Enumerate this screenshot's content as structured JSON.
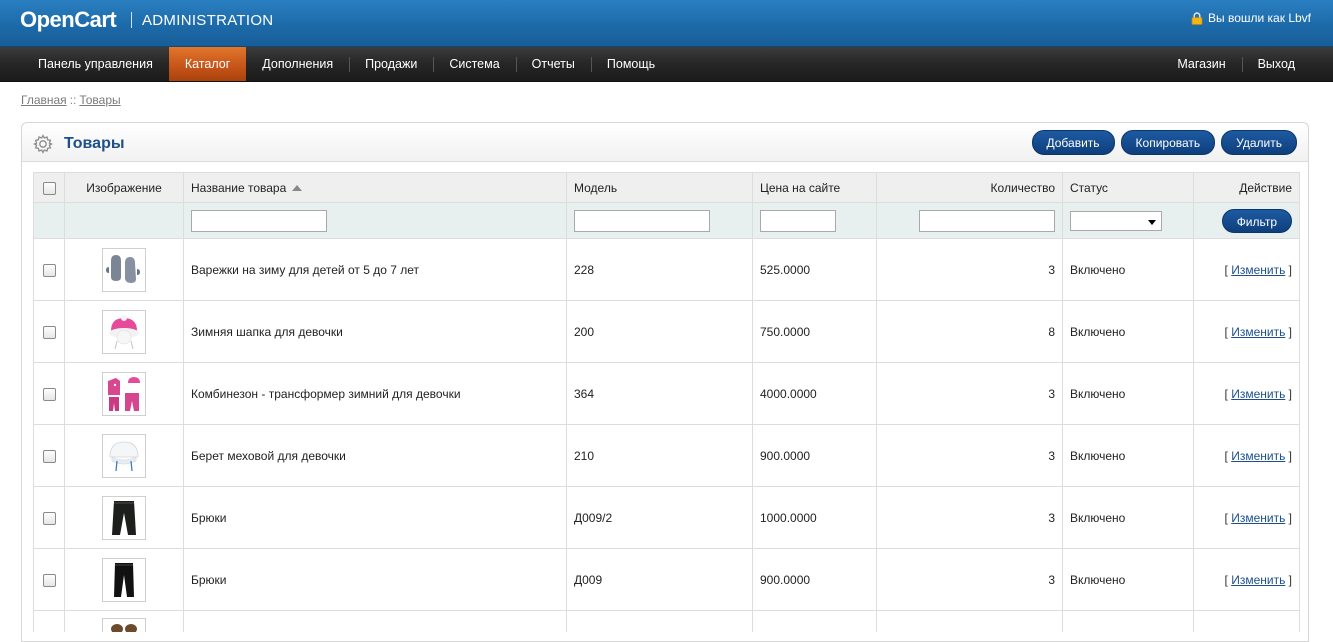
{
  "header": {
    "logo": "OpenCart",
    "subtitle": "ADMINISTRATION",
    "login_text": "Вы вошли как Lbvf"
  },
  "menu": {
    "left": [
      "Панель управления",
      "Каталог",
      "Дополнения",
      "Продажи",
      "Система",
      "Отчеты",
      "Помощь"
    ],
    "active": "Каталог",
    "right": [
      "Магазин",
      "Выход"
    ]
  },
  "breadcrumb": {
    "items": [
      "Главная",
      "Товары"
    ],
    "separator": "::"
  },
  "page": {
    "title": "Товары",
    "buttons": {
      "add": "Добавить",
      "copy": "Копировать",
      "delete": "Удалить"
    }
  },
  "table": {
    "columns": {
      "image": "Изображение",
      "name": "Название товара",
      "model": "Модель",
      "price": "Цена на сайте",
      "quantity": "Количество",
      "status": "Статус",
      "action": "Действие"
    },
    "filter_button": "Фильтр",
    "rows": [
      {
        "image": "mittens",
        "name": "Варежки на зиму для детей от 5 до 7 лет",
        "model": "228",
        "price": "525.0000",
        "quantity": "3",
        "status": "Включено",
        "action": "Изменить"
      },
      {
        "image": "pink-hat",
        "name": "Зимняя шапка для девочки",
        "model": "200",
        "price": "750.0000",
        "quantity": "8",
        "status": "Включено",
        "action": "Изменить"
      },
      {
        "image": "pink-suit",
        "name": "Комбинезон - трансформер зимний для девочки",
        "model": "364",
        "price": "4000.0000",
        "quantity": "3",
        "status": "Включено",
        "action": "Изменить"
      },
      {
        "image": "white-beret",
        "name": "Берет меховой для девочки",
        "model": "210",
        "price": "900.0000",
        "quantity": "3",
        "status": "Включено",
        "action": "Изменить"
      },
      {
        "image": "pants",
        "name": "Брюки",
        "model": "Д009/2",
        "price": "1000.0000",
        "quantity": "3",
        "status": "Включено",
        "action": "Изменить"
      },
      {
        "image": "pants",
        "name": "Брюки",
        "model": "Д009",
        "price": "900.0000",
        "quantity": "3",
        "status": "Включено",
        "action": "Изменить"
      }
    ]
  },
  "colors": {
    "header_blue": "#1d6aa9",
    "active_tab": "#c7561a",
    "button_blue": "#0f3f7d",
    "qty_low": "#f7931e",
    "qty_ok": "#2c7f2c"
  }
}
